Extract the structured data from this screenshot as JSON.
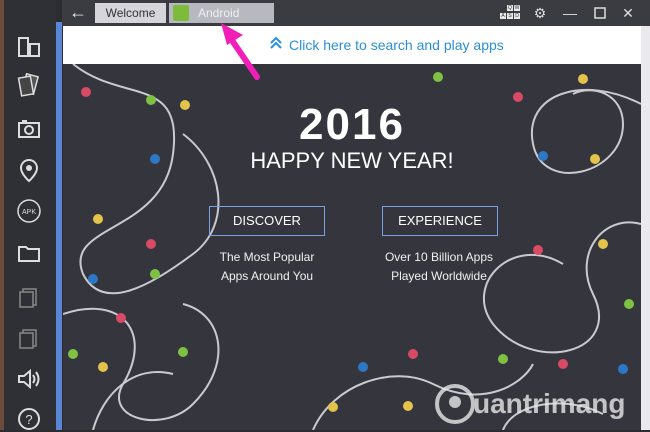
{
  "titlebar": {
    "back_icon": "back-arrow-icon",
    "tabs": [
      {
        "label": "Welcome"
      },
      {
        "label": "Android",
        "icon": "android-icon"
      }
    ],
    "keyboard_keys": [
      "Q",
      "W",
      "A",
      "S",
      "D"
    ],
    "controls": [
      "gear-icon",
      "minimize-icon",
      "maximize-icon",
      "close-icon"
    ]
  },
  "sidebar": {
    "items": [
      "multi-window-icon",
      "cards-icon",
      "camera-icon",
      "location-pin-icon",
      "apk-icon",
      "folder-icon",
      "copy-icon",
      "copy-icon-2",
      "volume-icon",
      "help-icon"
    ],
    "apk_label": "APK",
    "help_label": "?"
  },
  "search": {
    "text": "Click here to search and play apps"
  },
  "hero": {
    "year": "2016",
    "title": "HAPPY NEW YEAR!"
  },
  "cards": [
    {
      "button": "DISCOVER",
      "line1": "The Most Popular",
      "line2": "Apps Around You"
    },
    {
      "button": "EXPERIENCE",
      "line1": "Over 10 Billion Apps",
      "line2": "Played Worldwide"
    }
  ],
  "watermark": "uantrimang",
  "colors": {
    "accent": "#2b8fd8",
    "pink_arrow": "#f01fb8",
    "main_bg": "#35353d"
  }
}
